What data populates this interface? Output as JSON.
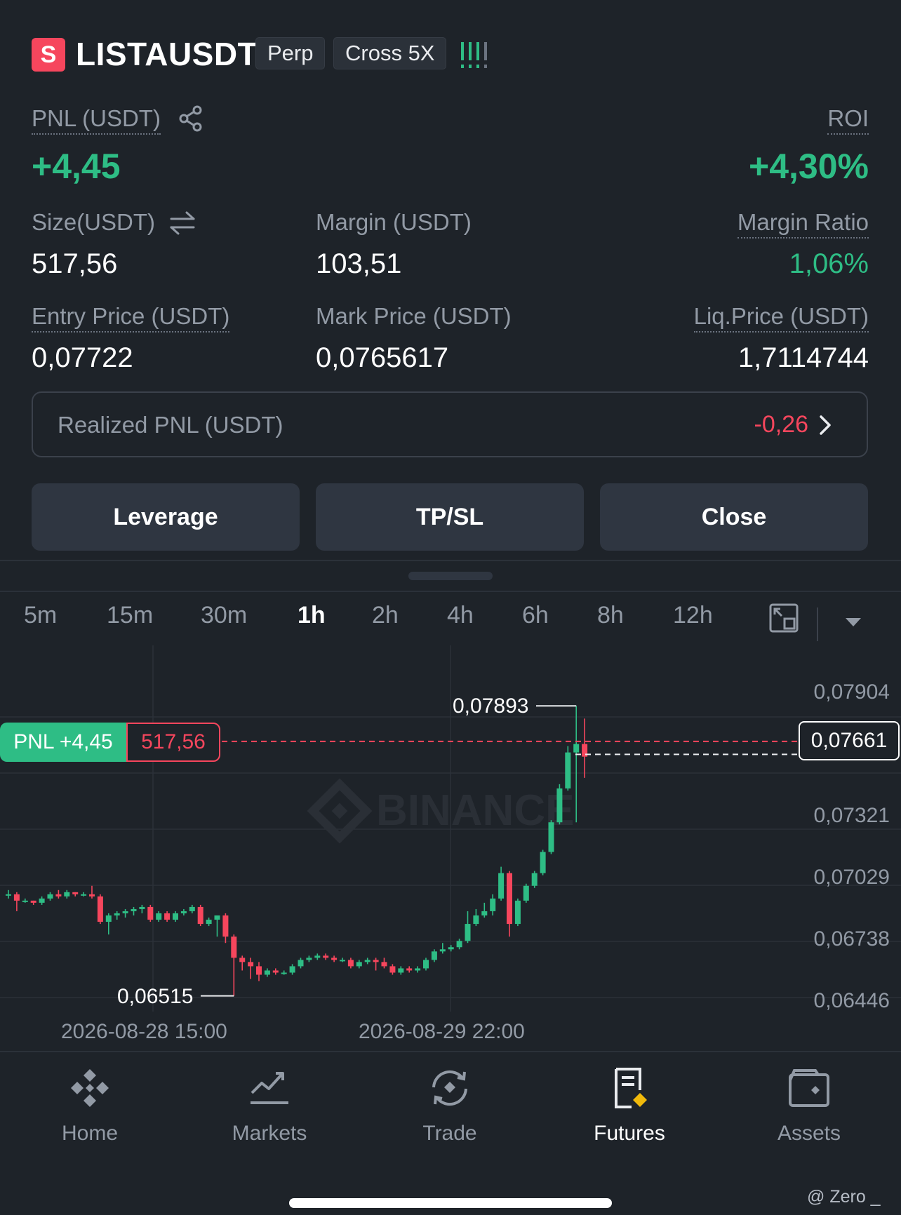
{
  "header": {
    "side_badge": "S",
    "symbol": "LISTAUSDT",
    "tags": [
      "Perp",
      "Cross 5X"
    ],
    "signal_text": "!!!!"
  },
  "position": {
    "pnl_label": "PNL (USDT)",
    "pnl_value": "+4,45",
    "roi_label": "ROI",
    "roi_value": "+4,30%",
    "size_label": "Size(USDT)",
    "size_value": "517,56",
    "margin_label": "Margin (USDT)",
    "margin_value": "103,51",
    "margin_ratio_label": "Margin Ratio",
    "margin_ratio_value": "1,06%",
    "entry_label": "Entry Price (USDT)",
    "entry_value": "0,07722",
    "mark_label": "Mark Price (USDT)",
    "mark_value": "0,0765617",
    "liq_label": "Liq.Price (USDT)",
    "liq_value": "1,7114744"
  },
  "realized": {
    "label": "Realized PNL (USDT)",
    "value": "-0,26"
  },
  "actions": {
    "leverage": "Leverage",
    "tpsl": "TP/SL",
    "close": "Close"
  },
  "timeframes": [
    "5m",
    "15m",
    "30m",
    "1h",
    "2h",
    "4h",
    "6h",
    "8h",
    "12h"
  ],
  "active_timeframe": "1h",
  "chart_data": {
    "type": "candlestick",
    "watermark": "BINANCE",
    "y_ticks": [
      "0,07904",
      "0,07321",
      "0,07029",
      "0,06738",
      "0,06446"
    ],
    "ylim": [
      0.06446,
      0.07904
    ],
    "x_ticks": [
      "2026-08-28 15:00",
      "2026-08-29 22:00"
    ],
    "high_label": "0,07893",
    "low_label": "0,06515",
    "current_price_label": "0,07661",
    "pnl_tag": "PNL +4,45",
    "pnl_size_tag": "517,56",
    "entry_price": 0.07722,
    "current_price": 0.07661,
    "candles": [
      [
        0.07,
        0.07,
        0.0702,
        0.0698
      ],
      [
        0.07,
        0.0697,
        0.0701,
        0.0692
      ],
      [
        0.0697,
        0.0697,
        0.0698,
        0.0696
      ],
      [
        0.0697,
        0.0696,
        0.0697,
        0.0695
      ],
      [
        0.0696,
        0.0698,
        0.0699,
        0.0695
      ],
      [
        0.0698,
        0.07,
        0.0701,
        0.0697
      ],
      [
        0.07,
        0.0699,
        0.0702,
        0.0698
      ],
      [
        0.0699,
        0.0701,
        0.0702,
        0.0698
      ],
      [
        0.0701,
        0.07,
        0.0701,
        0.0699
      ],
      [
        0.07,
        0.07,
        0.0701,
        0.0699
      ],
      [
        0.07,
        0.0699,
        0.0704,
        0.0698
      ],
      [
        0.0699,
        0.0687,
        0.07,
        0.0686
      ],
      [
        0.0687,
        0.069,
        0.0691,
        0.0681
      ],
      [
        0.069,
        0.0691,
        0.0692,
        0.0688
      ],
      [
        0.0691,
        0.0692,
        0.0693,
        0.0689
      ],
      [
        0.0692,
        0.0693,
        0.0694,
        0.069
      ],
      [
        0.0693,
        0.0694,
        0.0695,
        0.0691
      ],
      [
        0.0694,
        0.0688,
        0.0695,
        0.0687
      ],
      [
        0.0688,
        0.0691,
        0.0692,
        0.0687
      ],
      [
        0.0691,
        0.0688,
        0.0692,
        0.0687
      ],
      [
        0.0688,
        0.0691,
        0.0692,
        0.0687
      ],
      [
        0.0691,
        0.0692,
        0.0693,
        0.069
      ],
      [
        0.0692,
        0.0694,
        0.0695,
        0.0691
      ],
      [
        0.0694,
        0.0686,
        0.0695,
        0.0685
      ],
      [
        0.0686,
        0.0688,
        0.0689,
        0.0685
      ],
      [
        0.0688,
        0.069,
        0.069,
        0.068
      ],
      [
        0.069,
        0.068,
        0.0691,
        0.0677
      ],
      [
        0.068,
        0.067,
        0.0681,
        0.0652
      ],
      [
        0.067,
        0.0668,
        0.0671,
        0.0664
      ],
      [
        0.0668,
        0.0666,
        0.067,
        0.066
      ],
      [
        0.0666,
        0.0662,
        0.0668,
        0.0659
      ],
      [
        0.0662,
        0.0664,
        0.0665,
        0.0661
      ],
      [
        0.0664,
        0.0663,
        0.0665,
        0.0662
      ],
      [
        0.0663,
        0.0663,
        0.0664,
        0.0662
      ],
      [
        0.0663,
        0.0666,
        0.0667,
        0.0662
      ],
      [
        0.0666,
        0.0669,
        0.067,
        0.0665
      ],
      [
        0.0669,
        0.067,
        0.0671,
        0.0668
      ],
      [
        0.067,
        0.0671,
        0.0672,
        0.0669
      ],
      [
        0.0671,
        0.067,
        0.0672,
        0.0669
      ],
      [
        0.067,
        0.0669,
        0.0671,
        0.0668
      ],
      [
        0.0669,
        0.0669,
        0.067,
        0.0668
      ],
      [
        0.0669,
        0.0666,
        0.067,
        0.0665
      ],
      [
        0.0666,
        0.0668,
        0.0669,
        0.0665
      ],
      [
        0.0668,
        0.0669,
        0.067,
        0.0667
      ],
      [
        0.0669,
        0.0668,
        0.067,
        0.0664
      ],
      [
        0.0668,
        0.0666,
        0.067,
        0.0665
      ],
      [
        0.0666,
        0.0663,
        0.0667,
        0.0662
      ],
      [
        0.0663,
        0.0665,
        0.0666,
        0.0662
      ],
      [
        0.0665,
        0.0664,
        0.0666,
        0.0663
      ],
      [
        0.0664,
        0.0665,
        0.0666,
        0.0663
      ],
      [
        0.0665,
        0.0669,
        0.067,
        0.0664
      ],
      [
        0.0669,
        0.0673,
        0.0674,
        0.0668
      ],
      [
        0.0673,
        0.0674,
        0.0677,
        0.0672
      ],
      [
        0.0674,
        0.0675,
        0.0676,
        0.0673
      ],
      [
        0.0675,
        0.0678,
        0.0679,
        0.0674
      ],
      [
        0.0678,
        0.0686,
        0.0692,
        0.0677
      ],
      [
        0.0686,
        0.069,
        0.0693,
        0.0685
      ],
      [
        0.069,
        0.0692,
        0.0696,
        0.0689
      ],
      [
        0.0692,
        0.0698,
        0.07,
        0.069
      ],
      [
        0.0698,
        0.071,
        0.0713,
        0.0697
      ],
      [
        0.071,
        0.0686,
        0.0711,
        0.068
      ],
      [
        0.0686,
        0.0697,
        0.0698,
        0.0685
      ],
      [
        0.0697,
        0.0704,
        0.0705,
        0.0696
      ],
      [
        0.0704,
        0.071,
        0.0711,
        0.0703
      ],
      [
        0.071,
        0.072,
        0.0721,
        0.0709
      ],
      [
        0.072,
        0.0734,
        0.0735,
        0.0719
      ],
      [
        0.0734,
        0.075,
        0.0752,
        0.0733
      ],
      [
        0.075,
        0.0767,
        0.077,
        0.0749
      ],
      [
        0.0767,
        0.0771,
        0.0789,
        0.0734
      ],
      [
        0.0771,
        0.0765,
        0.0783,
        0.0755
      ]
    ]
  },
  "bottom_nav": [
    {
      "label": "Home",
      "icon": "binance-logo-icon"
    },
    {
      "label": "Markets",
      "icon": "markets-chart-icon"
    },
    {
      "label": "Trade",
      "icon": "trade-exchange-icon"
    },
    {
      "label": "Futures",
      "icon": "futures-doc-icon"
    },
    {
      "label": "Assets",
      "icon": "wallet-icon"
    }
  ],
  "active_nav": "Futures",
  "watermark_footer": "@ Zero _",
  "colors": {
    "up": "#2ebd85",
    "down": "#f6465d",
    "bg": "#1e2329",
    "accent": "#f0b90b"
  }
}
